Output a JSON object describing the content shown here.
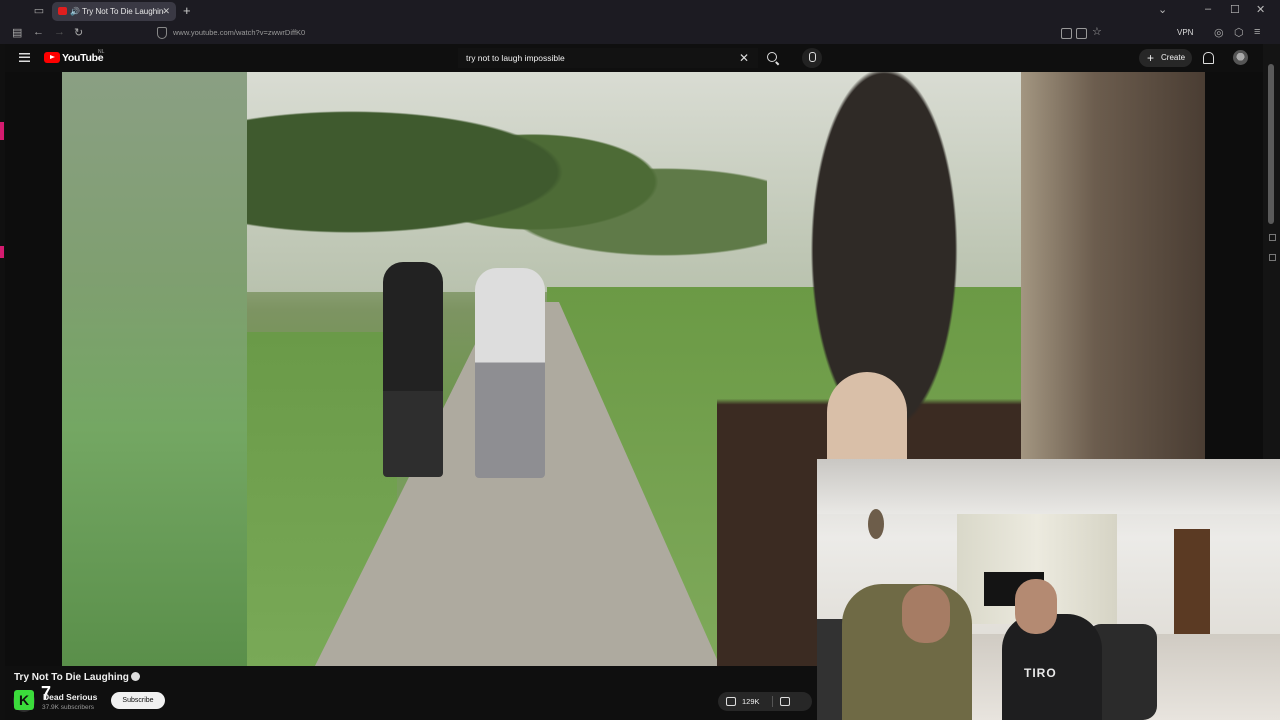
{
  "browser": {
    "tab_title": "Try Not To Die Laughing 💀",
    "tab_close": "✕",
    "new_tab": "+",
    "url": "www.youtube.com/watch?v=zwwrDiffK0",
    "vpn_label": "VPN",
    "window_controls": [
      "–",
      "☐",
      "✕"
    ]
  },
  "youtube": {
    "logo_text": "YouTube",
    "region": "NL",
    "search_query": "try not to laugh impossible",
    "search_clear": "✕",
    "create_label": "Create",
    "create_plus": "+"
  },
  "video": {
    "title": "Try Not To Die Laughing",
    "channel_name": "Dead Serious",
    "subscriber_count": "37.9K subscribers",
    "subscribe_label": "Subscribe",
    "like_count": "129K",
    "overlay_badge_letter": "K",
    "overlay_number": "7"
  },
  "webcam": {
    "shirt_text": "TIRO"
  },
  "colors": {
    "brand_red": "#ff0000",
    "overlay_green": "#3bdc3b",
    "background": "#0f0f0f"
  }
}
